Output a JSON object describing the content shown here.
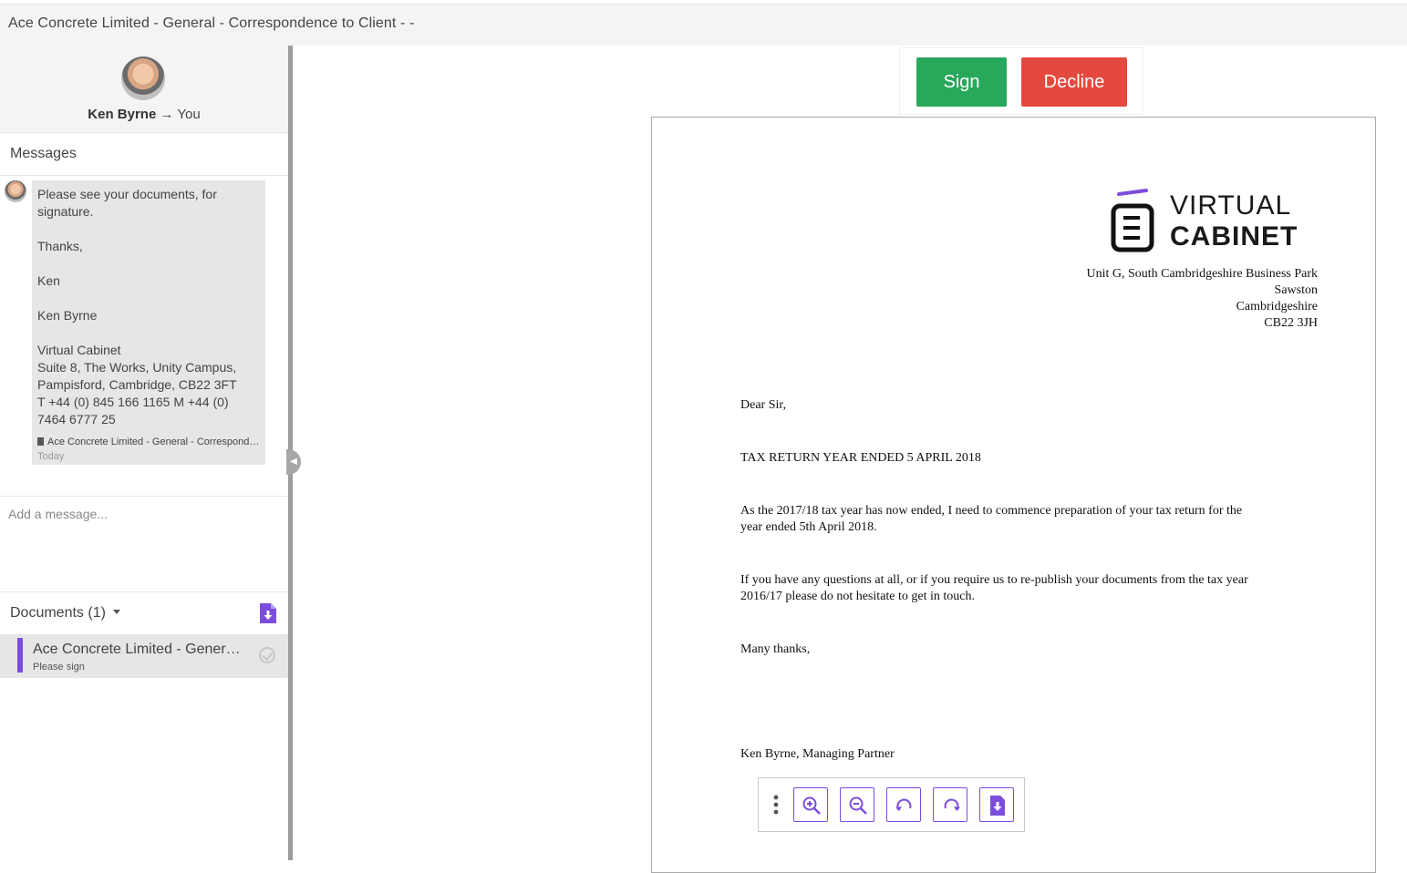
{
  "window": {
    "title": "Ace Concrete Limited - General - Correspondence to Client - -"
  },
  "profile": {
    "sender": "Ken Byrne",
    "arrow": "→",
    "recipient": "You"
  },
  "messages": {
    "heading": "Messages",
    "lines": [
      "Please see your documents, for signature.",
      "Thanks,",
      "Ken",
      "Ken Byrne",
      "Virtual Cabinet",
      "Suite 8, The Works, Unity Campus, Pampisford, Cambridge, CB22 3FT",
      "T +44 (0) 845 166 1165 M +44 (0) 7464 6777 25"
    ],
    "attachment": "Ace Concrete Limited - General - Correspondence to Client - -",
    "timestamp": "Today",
    "input_placeholder": "Add a message..."
  },
  "documents": {
    "heading": "Documents (1)",
    "items": [
      {
        "name": "Ace Concrete Limited - General - Correspondence to Client - -",
        "status": "Please sign"
      }
    ]
  },
  "actions": {
    "sign": "Sign",
    "decline": "Decline"
  },
  "letter": {
    "logo_line1": "VIRTUAL",
    "logo_line2": "CABINET",
    "address": [
      "Unit G, South Cambridgeshire Business Park",
      "Sawston",
      "Cambridgeshire",
      "CB22 3JH"
    ],
    "salutation": "Dear Sir,",
    "subject": "TAX RETURN YEAR ENDED 5 APRIL 2018",
    "para1_line1": "As the 2017/18 tax year has now ended, I need to commence preparation of your tax return for the",
    "para1_line2": "year ended 5th April 2018.",
    "para2_line1": "If you have any questions at all, or if you require us to re-publish your documents from the tax year",
    "para2_line2": "2016/17 please do not hesitate to get in touch.",
    "closing": "Many thanks,",
    "signature": "Ken Byrne, Managing Partner"
  },
  "colors": {
    "accent": "#7c4ddd",
    "sign": "#28a85a",
    "decline": "#e4493f"
  },
  "pdf_toolbar": {
    "icons": [
      "more-vertical-icon",
      "zoom-in-icon",
      "zoom-out-icon",
      "rotate-left-icon",
      "rotate-right-icon",
      "download-icon"
    ]
  }
}
